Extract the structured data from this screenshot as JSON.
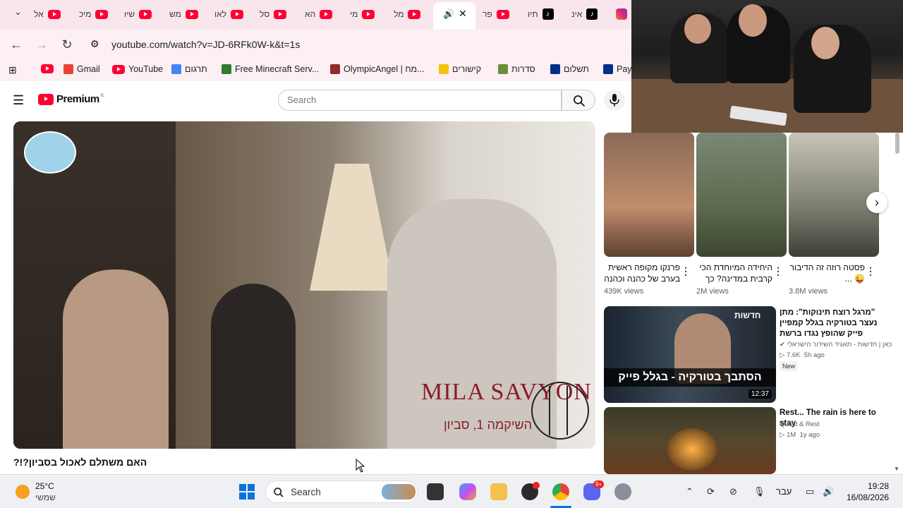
{
  "browser": {
    "tabs": [
      {
        "label": "אל",
        "icon": "youtube"
      },
      {
        "label": "מיכ",
        "icon": "youtube"
      },
      {
        "label": "שיו",
        "icon": "youtube"
      },
      {
        "label": "מש",
        "icon": "youtube"
      },
      {
        "label": "לאו",
        "icon": "youtube"
      },
      {
        "label": "סל",
        "icon": "youtube"
      },
      {
        "label": "הא",
        "icon": "youtube"
      },
      {
        "label": "מי",
        "icon": "youtube"
      },
      {
        "label": "מל",
        "icon": "youtube"
      },
      {
        "label": "פר",
        "icon": "youtube"
      },
      {
        "label": "תיו",
        "icon": "tiktok"
      },
      {
        "label": "אינ",
        "icon": "tiktok"
      }
    ],
    "url": "youtube.com/watch?v=JD-6RFk0W-k&t=1s",
    "bookmarks": [
      {
        "label": "Gmail",
        "color": "#ea4335"
      },
      {
        "label": "YouTube",
        "color": "#ff0033"
      },
      {
        "label": "תרגום",
        "color": "#4285f4"
      },
      {
        "label": "Free Minecraft Serv...",
        "color": "#2e7d32"
      },
      {
        "label": "OlympicAngel | מח...",
        "color": "#8e2c2c"
      },
      {
        "label": "קישורים",
        "color": "#f4c20d"
      },
      {
        "label": "סדרות",
        "color": "#6a8e3d"
      },
      {
        "label": "תשלום",
        "color": "#003087"
      },
      {
        "label": "Payl",
        "color": "#003087"
      }
    ]
  },
  "youtube": {
    "logo": "Premium",
    "country": "IL",
    "search_placeholder": "Search",
    "video": {
      "title": "האם משתלם לאכול בסביון?!?",
      "overlay_brand": "MILA SAVYON",
      "overlay_sub": "השיקמה 1, סביון"
    },
    "shorts": [
      {
        "title": "פרנקו מקופה ראשית בערב של כהנה וכהנה",
        "views": "439K views"
      },
      {
        "title": "היחידה המיוחדת הכי קרבית במדינה? כך ...",
        "views": "2M views"
      },
      {
        "title": "פסטה רוזה זה הדיבור 😜 ...",
        "views": "3.8M views"
      }
    ],
    "recommended": [
      {
        "title": "\"מרגל רוצח תינוקות\": מתן נעצר בטורקיה בגלל קמפיין פייק שהופץ נגדו ברשת",
        "channel": "כאן | חדשות - תאגיד השידור הישראלי",
        "views": "7.6K",
        "age": "5h ago",
        "badge": "New",
        "duration": "12:37",
        "thumb_caption": "הסתבך בטורקיה - בגלל פייק",
        "thumb_label": "חדשות"
      },
      {
        "title": "Rest... The rain is here to stay",
        "channel": "Quest & Rest",
        "views": "1M",
        "age": "1y ago"
      }
    ]
  },
  "taskbar": {
    "weather_temp": "25°C",
    "weather_desc": "שמשי",
    "search_label": "Search",
    "language": "עבר",
    "time": "19:28",
    "date": "16/08/2026",
    "discord_badge": "9+"
  }
}
